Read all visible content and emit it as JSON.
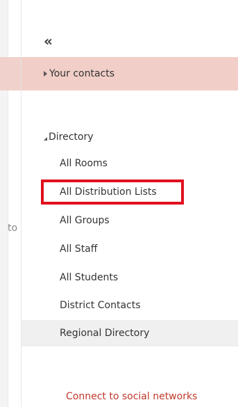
{
  "left_pane": {
    "partial_text": "to"
  },
  "panel": {
    "collapse_label": "«",
    "your_contacts": "Your contacts",
    "directory": {
      "header": "Directory",
      "items": [
        {
          "label": "All Rooms"
        },
        {
          "label": "All Distribution Lists"
        },
        {
          "label": "All Groups"
        },
        {
          "label": "All Staff"
        },
        {
          "label": "All Students"
        },
        {
          "label": "District Contacts"
        },
        {
          "label": "Regional Directory"
        }
      ]
    },
    "social_link": "Connect to social networks"
  },
  "colors": {
    "highlight_row": "#f1cec7",
    "annotation_box": "#e01020",
    "link": "#c0392b",
    "selected_row": "#f0f0f0"
  }
}
